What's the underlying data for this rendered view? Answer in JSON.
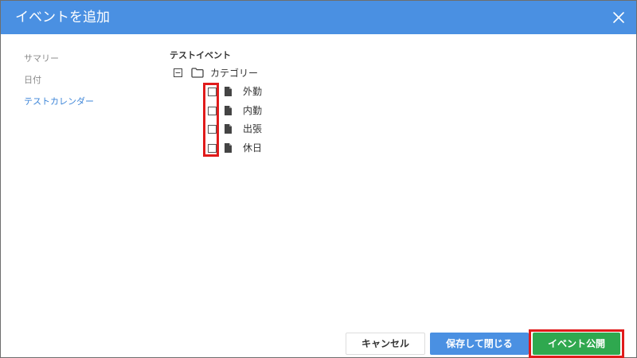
{
  "dialog": {
    "title": "イベントを追加",
    "close_icon": "close-icon",
    "header_color": "#4a90e2"
  },
  "sidebar": {
    "items": [
      {
        "label": "サマリー",
        "active": false
      },
      {
        "label": "日付",
        "active": false
      },
      {
        "label": "テストカレンダー",
        "active": true
      }
    ]
  },
  "tree": {
    "title": "テストイベント",
    "root": {
      "label": "カテゴリー",
      "expanded": true,
      "icons": [
        "collapse-icon",
        "folder-icon"
      ]
    },
    "items": [
      {
        "label": "外勤",
        "checked": false,
        "icon": "file-icon"
      },
      {
        "label": "内勤",
        "checked": false,
        "icon": "file-icon"
      },
      {
        "label": "出張",
        "checked": false,
        "icon": "file-icon"
      },
      {
        "label": "休日",
        "checked": false,
        "icon": "file-icon"
      }
    ]
  },
  "footer": {
    "cancel_label": "キャンセル",
    "save_label": "保存して閉じる",
    "publish_label": "イベント公開"
  },
  "colors": {
    "accent": "#4a90e2",
    "publish": "#2fa84f",
    "highlight": "#e01b1b",
    "active_link": "#3d85d8"
  }
}
